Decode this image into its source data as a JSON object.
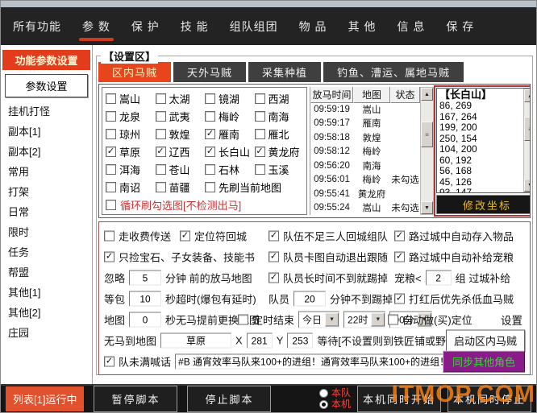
{
  "watermark": "ITMOP.COM",
  "menu": {
    "items": [
      {
        "label": "所有功能",
        "active": false
      },
      {
        "label": "参 数",
        "active": true
      },
      {
        "label": "保 护",
        "active": false
      },
      {
        "label": "技 能",
        "active": false
      },
      {
        "label": "组队组团",
        "active": false
      },
      {
        "label": "物 品",
        "active": false
      },
      {
        "label": "其 他",
        "active": false
      },
      {
        "label": "信 息",
        "active": false
      },
      {
        "label": "保 存",
        "active": false
      }
    ]
  },
  "sidebar": {
    "title": "功能参数设置",
    "button": "参数设置",
    "items": [
      "挂机打怪",
      "副本[1]",
      "副本[2]",
      "常用",
      "打架",
      "日常",
      "限时",
      "任务",
      "帮盟",
      "其他[1]",
      "其他[2]",
      "庄园"
    ]
  },
  "settings": {
    "group_label": "【设置区】",
    "tabs": [
      {
        "label": "区内马贼",
        "active": true
      },
      {
        "label": "天外马贼",
        "active": false
      },
      {
        "label": "采集种植",
        "active": false
      },
      {
        "label": "钓鱼、漕运、属地马贼",
        "active": false
      }
    ],
    "maps": {
      "items": [
        {
          "label": "嵩山",
          "checked": false
        },
        {
          "label": "太湖",
          "checked": false
        },
        {
          "label": "镜湖",
          "checked": false
        },
        {
          "label": "西湖",
          "checked": false
        },
        {
          "label": "龙泉",
          "checked": false
        },
        {
          "label": "武夷",
          "checked": false
        },
        {
          "label": "梅岭",
          "checked": false
        },
        {
          "label": "南海",
          "checked": false
        },
        {
          "label": "琼州",
          "checked": false
        },
        {
          "label": "敦煌",
          "checked": false
        },
        {
          "label": "雁南",
          "checked": true
        },
        {
          "label": "雁北",
          "checked": false
        },
        {
          "label": "草原",
          "checked": true
        },
        {
          "label": "辽西",
          "checked": true
        },
        {
          "label": "长白山",
          "checked": true
        },
        {
          "label": "黄龙府",
          "checked": true
        },
        {
          "label": "洱海",
          "checked": false
        },
        {
          "label": "苍山",
          "checked": false
        },
        {
          "label": "石林",
          "checked": false
        },
        {
          "label": "玉溪",
          "checked": false
        },
        {
          "label": "南诏",
          "checked": false
        },
        {
          "label": "苗疆",
          "checked": false
        },
        {
          "label": "先刷当前地图",
          "checked": false,
          "wide": true
        }
      ],
      "loop_option": {
        "label": "循环刷勾选图[不检测出马]",
        "checked": false
      }
    },
    "table": {
      "headers": [
        "放马时间",
        "地图",
        "状态"
      ],
      "rows": [
        [
          "09:59:19",
          "嵩山",
          ""
        ],
        [
          "09:59:17",
          "雁南",
          ""
        ],
        [
          "09:58:18",
          "敦煌",
          ""
        ],
        [
          "09:58:12",
          "梅岭",
          ""
        ],
        [
          "09:56:20",
          "南海",
          ""
        ],
        [
          "09:56:01",
          "梅岭",
          "未勾选"
        ],
        [
          "09:55:41",
          "黄龙府",
          ""
        ],
        [
          "09:55:24",
          "嵩山",
          "未勾选"
        ]
      ]
    },
    "coords": {
      "title": "【长白山】",
      "points": [
        "86, 269",
        "167, 264",
        "199, 200",
        "250, 154",
        "104, 200",
        "60, 192",
        "56, 168",
        "45, 126",
        "93, 147"
      ],
      "edit_button": "修改坐标"
    },
    "opts": {
      "pay_teleport": {
        "label": "走收费传送",
        "checked": false
      },
      "locator_return": {
        "label": "定位符回城",
        "checked": true
      },
      "team_return": {
        "label": "队伍不足三人回城组队",
        "checked": true
      },
      "store_items": {
        "label": "路过城中自动存入物品",
        "checked": true
      },
      "pick_only": {
        "label": "只捡宝石、子女装备、技能书",
        "checked": true
      },
      "member_stuck": {
        "label": "队员卡图自动退出跟随",
        "checked": true
      },
      "petfood_resupply": {
        "label": "路过城中自动补给宠粮",
        "checked": true
      },
      "ignore_prefix": "忽略",
      "ignore_value": "5",
      "ignore_suffix": "分钟 前的放马地图",
      "kick_late": {
        "label": "队员长时间不到就踢掉",
        "checked": true
      },
      "petfood_prefix": "宠粮<",
      "petfood_value": "2",
      "petfood_suffix": "组 过城补给",
      "bag_prefix": "等包",
      "bag_value": "10",
      "bag_suffix": "秒超时(爆包有延时)",
      "member_prefix": "队员",
      "member_value": "20",
      "member_suffix": "分钟不到踢掉",
      "red_priority": {
        "label": "打红后优先杀低血马贼",
        "checked": true
      },
      "map_prefix": "地图",
      "map_value": "0",
      "map_suffix": "秒无马提前更换地图",
      "timer_end": {
        "label": "定时结束",
        "checked": false
      },
      "timer_day": "今日",
      "timer_hour": "22时",
      "timer_min": "00分",
      "auto_locator": {
        "label": "自动做(买)定位",
        "checked": false
      },
      "settings_button": "设置",
      "nohorse_label": "无马到地图",
      "nohorse_map": "草原",
      "x_label": "X",
      "x_value": "281",
      "y_label": "Y",
      "y_value": "253",
      "wait_note": "等待[不设置则到铁匠铺或野外传送等待]",
      "start_button": "启动区内马贼",
      "shout": {
        "label": "队未满喊话",
        "checked": true,
        "value": "#B 通宵效率马队来100+的进组！通宵效率马队来100+的进组！"
      },
      "sync_button": "同步其他角色"
    }
  },
  "footer": {
    "status": "列表[1]运行中",
    "pause": "暂停脚本",
    "stop": "停止脚本",
    "radio_team": {
      "label": "本队",
      "selected": false
    },
    "radio_machine": {
      "label": "本机",
      "selected": true
    },
    "start_all": "本机同时开始",
    "stop_all": "本机同时停止"
  }
}
